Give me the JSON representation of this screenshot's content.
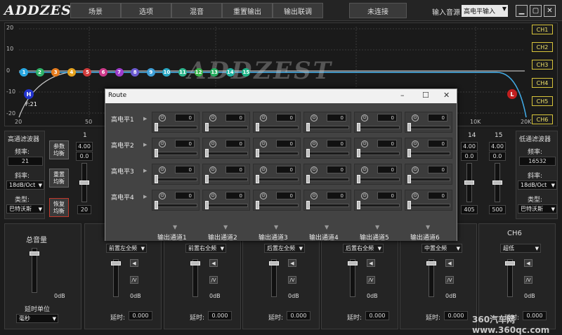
{
  "app": {
    "logo": "ADDZEST"
  },
  "toolbar": {
    "tabs": [
      "场景",
      "选项",
      "混音",
      "重置输出",
      "输出联调"
    ],
    "connect_status": "未连接",
    "input_source_label": "输入音源",
    "input_source_value": "高电平输入"
  },
  "eq": {
    "y_ticks": [
      "20",
      "10",
      "0",
      "-10",
      "-20"
    ],
    "x_ticks": [
      "20",
      "50",
      "10K",
      "20K"
    ],
    "channels": [
      "CH1",
      "CH2",
      "CH3",
      "CH4",
      "CH5",
      "CH6"
    ],
    "nodes": [
      "1",
      "2",
      "3",
      "4",
      "5",
      "6",
      "7",
      "8",
      "9",
      "10",
      "11",
      "12",
      "13",
      "14",
      "15"
    ],
    "node_colors": [
      "#29a7e1",
      "#2fb36a",
      "#e67d1f",
      "#e6a31f",
      "#d03b3b",
      "#cc3a8a",
      "#9e3ccc",
      "#6b5ad0",
      "#3fa0d8",
      "#2aa8c4",
      "#2eb58d",
      "#39b54a",
      "#27ae60",
      "#1fb5a3",
      "#1fb588"
    ],
    "hp_label": "H",
    "lp_label": "L",
    "hp_freq": "F:21",
    "watermark": "ADDZEST"
  },
  "hpf": {
    "title": "高通滤波器",
    "freq_label": "频率:",
    "freq_value": "21",
    "slope_label": "斜率:",
    "slope_value": "18dB/Oct",
    "type_label": "类型:",
    "type_value": "巴特沃斯"
  },
  "lpf": {
    "title": "低通滤波器",
    "freq_label": "频率:",
    "freq_value": "16532",
    "slope_label": "斜率:",
    "slope_value": "18dB/Oct",
    "type_label": "类型:",
    "type_value": "巴特沃斯"
  },
  "side_buttons": {
    "param": "参数\n均衡",
    "reset": "重置\n均衡",
    "restore": "恢复\n均衡"
  },
  "band1": {
    "index": "1",
    "gain": "4.00",
    "q": "0.0",
    "freq": "20"
  },
  "band14": {
    "index": "14",
    "gain": "4.00",
    "q": "0.0",
    "freq": "405"
  },
  "band15": {
    "index": "15",
    "gain": "4.00",
    "q": "0.0",
    "freq": "500"
  },
  "master": {
    "title": "总音量",
    "db": "0dB",
    "delay_unit_label": "延时单位",
    "delay_unit_value": "毫秒"
  },
  "outputs": [
    {
      "speaker": "前置左全频",
      "db": "0dB",
      "delay_label": "延时:",
      "delay": "0.000"
    },
    {
      "speaker": "前置右全频",
      "db": "0dB",
      "delay_label": "延时:",
      "delay": "0.000"
    },
    {
      "speaker": "后置左全频",
      "db": "0dB",
      "delay_label": "延时:",
      "delay": "0.000"
    },
    {
      "speaker": "后置右全频",
      "db": "0dB",
      "delay_label": "延时:",
      "delay": "0.000"
    },
    {
      "speaker": "中置全频",
      "db": "0dB",
      "delay_label": "延时:",
      "delay": "0.000"
    },
    {
      "speaker": "超低",
      "db": "0dB",
      "delay_label": "延时:",
      "delay": "0.000",
      "channel": "CH6"
    }
  ],
  "route": {
    "title": "Route",
    "rows": [
      "高电平1",
      "高电平2",
      "高电平3",
      "高电平4"
    ],
    "cols": [
      "输出通道1",
      "输出通道2",
      "输出通道3",
      "输出通道4",
      "输出通道5",
      "输出通道6"
    ],
    "cell_value": "0"
  },
  "site_watermark": "360汽车网 www.360qc.com"
}
